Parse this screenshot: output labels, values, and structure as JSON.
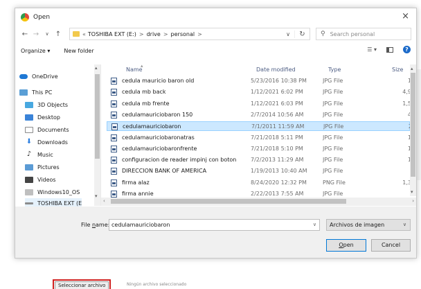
{
  "dialog": {
    "title": "Open",
    "close_glyph": "×",
    "nav": {
      "back": "←",
      "forward": "→",
      "dropdown": "∨",
      "up": "↑"
    },
    "address": {
      "prefix": "«",
      "crumbs": [
        "TOSHIBA EXT (E:)",
        "drive",
        "personal"
      ],
      "separator": ">",
      "dropdown": "∨",
      "refresh": "↻"
    },
    "search": {
      "placeholder": "Search personal",
      "icon": "search-icon"
    },
    "toolbar": {
      "organize": "Organize ▾",
      "new_folder": "New folder",
      "view_glyph": "☰ ▾",
      "help": "?"
    },
    "sidebar": {
      "items": [
        {
          "label": "OneDrive",
          "icon": "cloud-icon"
        },
        {
          "label": "This PC",
          "icon": "computer-icon"
        },
        {
          "label": "3D Objects",
          "icon": "cube-icon"
        },
        {
          "label": "Desktop",
          "icon": "desktop-icon"
        },
        {
          "label": "Documents",
          "icon": "documents-icon"
        },
        {
          "label": "Downloads",
          "icon": "download-icon"
        },
        {
          "label": "Music",
          "icon": "music-icon"
        },
        {
          "label": "Pictures",
          "icon": "pictures-icon"
        },
        {
          "label": "Videos",
          "icon": "video-icon"
        },
        {
          "label": "Windows10_OS",
          "icon": "disk-icon"
        },
        {
          "label": "TOSHIBA EXT (E",
          "icon": "usb-drive-icon"
        }
      ]
    },
    "columns": {
      "name": "Name",
      "date": "Date modified",
      "type": "Type",
      "size": "Size"
    },
    "files": [
      {
        "name": "cedula mauricio baron old",
        "date": "5/23/2016 10:38 PM",
        "type": "JPG File",
        "size": "1"
      },
      {
        "name": "cedula mb back",
        "date": "1/12/2021 6:02 PM",
        "type": "JPG File",
        "size": "4,9"
      },
      {
        "name": "cedula mb frente",
        "date": "1/12/2021 6:03 PM",
        "type": "JPG File",
        "size": "1,5"
      },
      {
        "name": "cedulamauriciobaron 150",
        "date": "2/7/2014 10:56 AM",
        "type": "JPG File",
        "size": "4"
      },
      {
        "name": "cedulamauriciobaron",
        "date": "7/1/2011 11:59 AM",
        "type": "JPG File",
        "size": "2"
      },
      {
        "name": "cedulamauriciobaronatras",
        "date": "7/21/2018 5:11 PM",
        "type": "JPG File",
        "size": "1"
      },
      {
        "name": "cedulamauriciobaronfrente",
        "date": "7/21/2018 5:10 PM",
        "type": "JPG File",
        "size": "1"
      },
      {
        "name": "configuracion de reader impinj con boton",
        "date": "7/2/2013 11:29 AM",
        "type": "JPG File",
        "size": "1"
      },
      {
        "name": "DIRECCION BANK OF AMERICA",
        "date": "1/19/2013 10:40 AM",
        "type": "JPG File",
        "size": ""
      },
      {
        "name": "firma alaz",
        "date": "8/24/2020 12:32 PM",
        "type": "PNG File",
        "size": "1,3"
      },
      {
        "name": "firma annie",
        "date": "2/22/2013 7:55 AM",
        "type": "JPG File",
        "size": ""
      }
    ],
    "selected_index": 4,
    "footer": {
      "file_name_label_pre": "File ",
      "file_name_label_u": "n",
      "file_name_label_post": "ame:",
      "file_name_value": "cedulamauriciobaron",
      "file_type": "Archivos de imagen",
      "open_u": "O",
      "open_rest": "pen",
      "cancel": "Cancel",
      "dropdown": "∨"
    },
    "scroll": {
      "up": "▴",
      "down": "▾",
      "left": "‹",
      "right": "›"
    }
  },
  "page": {
    "choose_file_button": "Seleccionar archivo",
    "no_file_text": "Ningún archivo seleccionado"
  }
}
